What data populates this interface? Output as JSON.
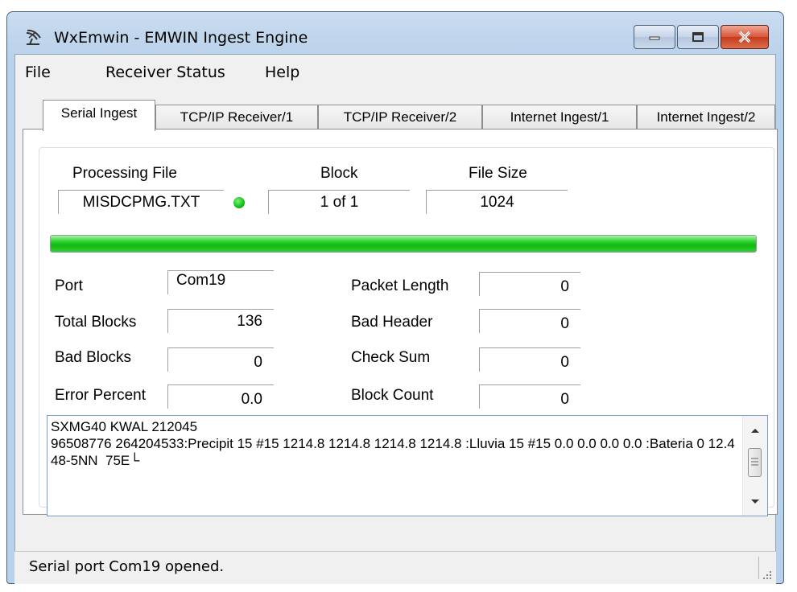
{
  "window": {
    "title": "WxEmwin - EMWIN Ingest Engine",
    "icon": "satellite-dish-icon",
    "controls": {
      "minimize": "minimize-icon",
      "maximize": "maximize-icon",
      "close": "close-icon"
    },
    "close_color": "#c33b1d"
  },
  "menu": {
    "file": "File",
    "receiver_status": "Receiver Status",
    "help": "Help"
  },
  "tabs": [
    "Serial Ingest",
    "TCP/IP Receiver/1",
    "TCP/IP Receiver/2",
    "Internet Ingest/1",
    "Internet Ingest/2"
  ],
  "active_tab": "Serial Ingest",
  "processing": {
    "file_label": "Processing File",
    "file_value": "MISDCPMG.TXT",
    "block_label": "Block",
    "block_value": "1 of 1",
    "size_label": "File Size",
    "size_value": "1024",
    "led_color": "#11c011"
  },
  "progress": {
    "fraction": 1.0,
    "color": "#0fb80f"
  },
  "stats": {
    "port_label": "Port",
    "port_value": "Com19",
    "total_blocks_label": "Total Blocks",
    "total_blocks_value": "136",
    "bad_blocks_label": "Bad Blocks",
    "bad_blocks_value": "0",
    "error_percent_label": "Error Percent",
    "error_percent_value": "0.0",
    "packet_length_label": "Packet Length",
    "packet_length_value": "0",
    "bad_header_label": "Bad Header",
    "bad_header_value": "0",
    "check_sum_label": "Check Sum",
    "check_sum_value": "0",
    "block_count_label": "Block Count",
    "block_count_value": "0"
  },
  "message": {
    "text": "SXMG40 KWAL 212045\n96508776 264204533:Precipit 15 #15 1214.8 1214.8 1214.8 1214.8 :Lluvia 15 #15 0.0 0.0 0.0 0.0 :Bateria 0 12.4  48-5NN  75E└"
  },
  "status": {
    "text": "Serial port Com19 opened."
  }
}
